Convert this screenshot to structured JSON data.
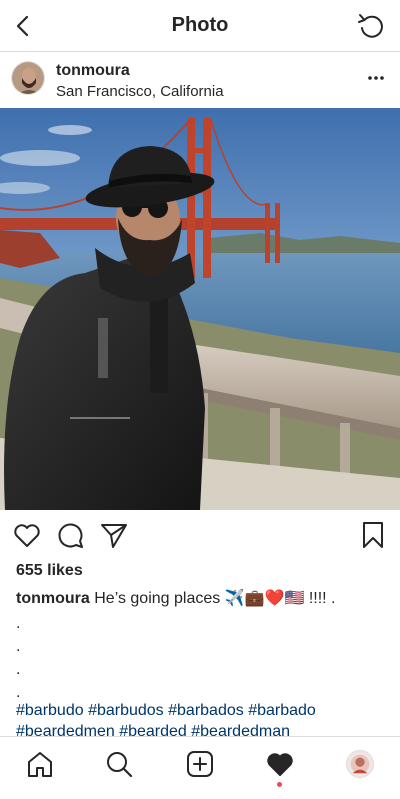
{
  "header": {
    "title": "Photo"
  },
  "post": {
    "username": "tonmoura",
    "location": "San Francisco, California",
    "likes": "655 likes",
    "caption_user": "tonmoura",
    "caption_text": "He’s going places ✈️💼❤️🇺🇸 !!!! .",
    "dots": [
      ".",
      ".",
      ".",
      "."
    ],
    "hashtags_line1": "#barbudo #barbudos #barbados #barbado",
    "hashtags_line2": "#beardedmen #bearded #beardedman"
  },
  "colors": {
    "text": "#262626",
    "hashtag": "#003569",
    "divider": "#dbdbdb",
    "notification": "#ed4956"
  },
  "icons": {
    "top": [
      "chevron-left-icon",
      "refresh-icon"
    ],
    "post": [
      "more-icon",
      "heart-outline-icon",
      "comment-icon",
      "share-icon",
      "bookmark-icon"
    ],
    "tabs": [
      "home-icon",
      "search-icon",
      "add-post-icon",
      "heart-filled-icon",
      "profile-avatar"
    ]
  }
}
